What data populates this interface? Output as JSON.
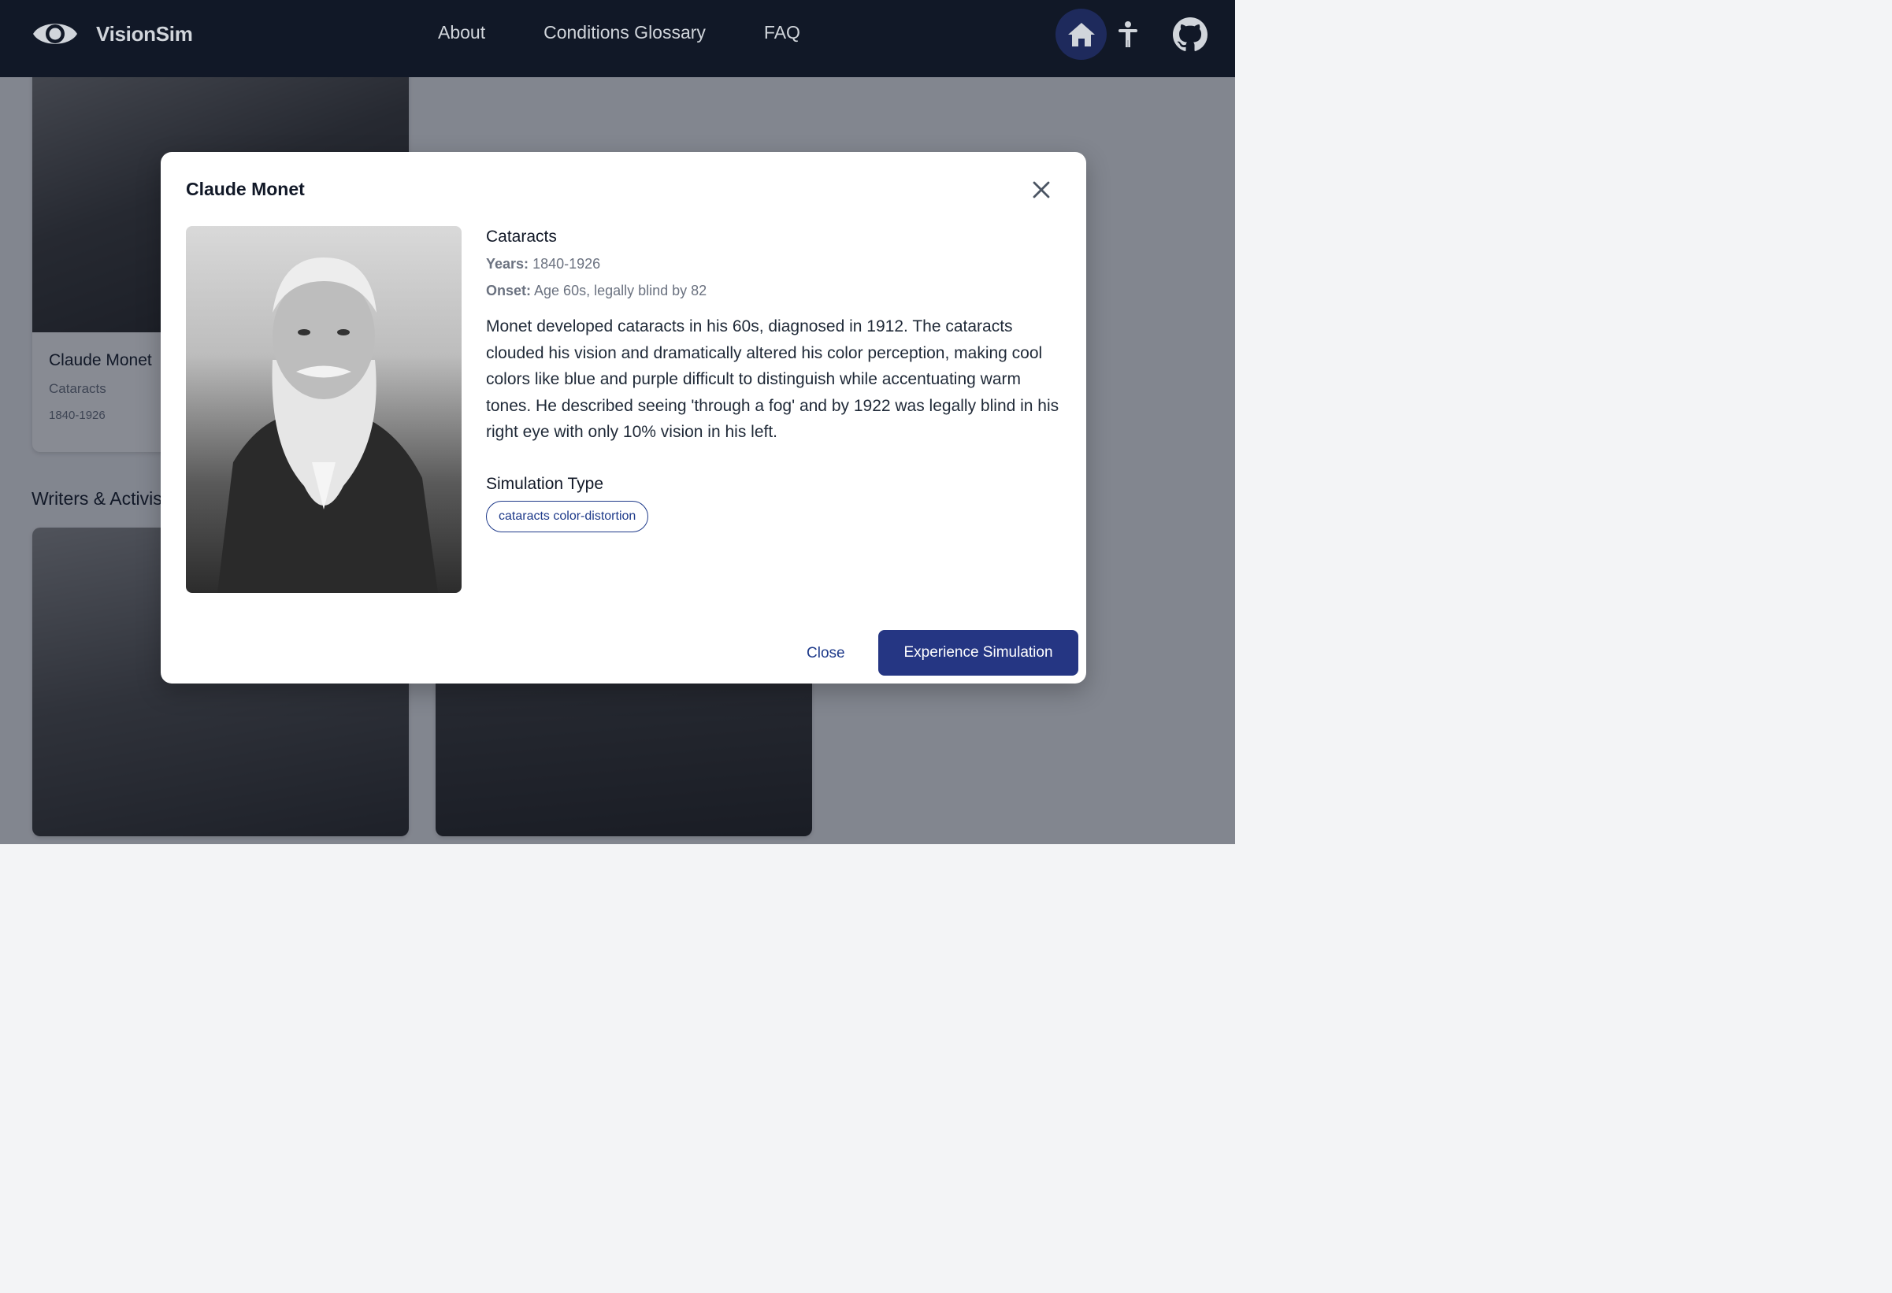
{
  "header": {
    "brand": "VisionSim",
    "nav": [
      "About",
      "Conditions Glossary",
      "FAQ"
    ]
  },
  "background": {
    "card": {
      "name": "Claude Monet",
      "condition": "Cataracts",
      "years": "1840-1926"
    },
    "section_title": "Writers & Activis"
  },
  "modal": {
    "title": "Claude Monet",
    "condition": "Cataracts",
    "years_label": "Years:",
    "years": "1840-1926",
    "onset_label": "Onset:",
    "onset": "Age 60s, legally blind by 82",
    "description": "Monet developed cataracts in his 60s, diagnosed in 1912. The cataracts clouded his vision and dramatically altered his color perception, making cool colors like blue and purple difficult to distinguish while accentuating warm tones. He described seeing 'through a fog' and by 1922 was legally blind in his right eye with only 10% vision in his left.",
    "simulation_heading": "Simulation Type",
    "simulation_badge": "cataracts color-distortion",
    "close_label": "Close",
    "primary_label": "Experience Simulation"
  },
  "icons": {
    "logo": "eye-icon",
    "home": "home-icon",
    "accessibility": "accessibility-icon",
    "github": "github-icon",
    "close": "close-icon"
  },
  "colors": {
    "navbar": "#111827",
    "primary": "#253683",
    "badge_border": "#1e3a8a"
  }
}
